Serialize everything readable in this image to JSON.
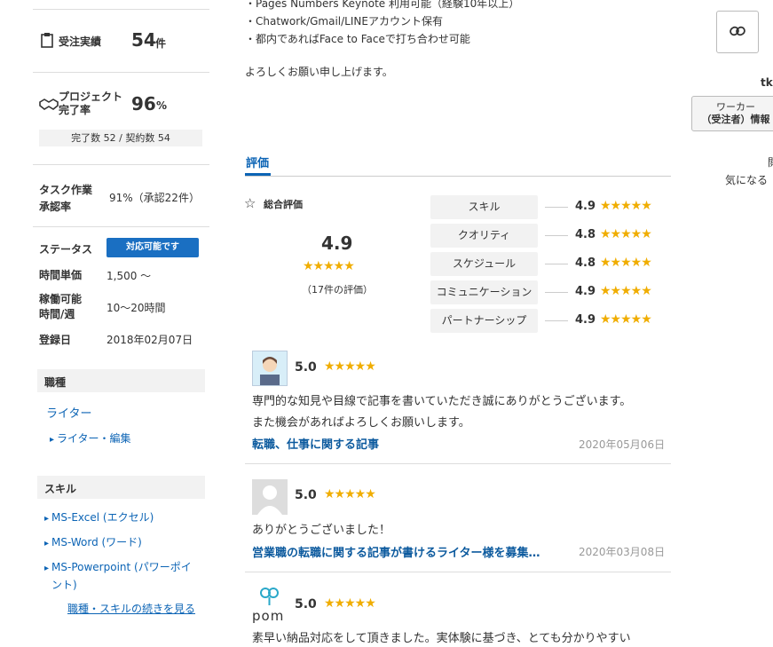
{
  "left": {
    "orders": {
      "label": "受注実績",
      "value": "54",
      "unit": "件"
    },
    "completion": {
      "label_line1": "プロジェクト",
      "label_line2": "完了率",
      "value": "96",
      "unit": "%",
      "detail": "完了数 52 / 契約数 54"
    },
    "task": {
      "label_line1": "タスク作業",
      "label_line2": "承認率",
      "value": "91%（承認22件）"
    },
    "status": {
      "label": "ステータス",
      "badge": "対応可能です"
    },
    "hourly": {
      "label": "時間単価",
      "value": "1,500 ～"
    },
    "hours": {
      "label_line1": "稼働可能",
      "label_line2": "時間/週",
      "value": "10～20時間"
    },
    "registered": {
      "label": "登録日",
      "value": "2018年02月07日"
    },
    "job_section": {
      "title": "職種",
      "category": "ライター",
      "sub": "ライター・編集"
    },
    "skill_section": {
      "title": "スキル",
      "items": [
        "MS-Excel (エクセル)",
        "MS-Word (ワード)",
        "MS-Powerpoint (パワーポイ",
        "ント)"
      ],
      "more_link": "職種・スキルの続きを見る"
    }
  },
  "intro": {
    "lines": [
      "・Pages Numbers Keynote 利用可能（経験10年以上）",
      "・Chatwork/Gmail/LINEアカウント保有",
      "・都内であればFace to Faceで打ち合わせ可能"
    ],
    "closing": "よろしくお願い申し上げます。"
  },
  "tab": {
    "label": "評価"
  },
  "overall": {
    "label": "総合評価",
    "score": "4.9",
    "stars": "★★★★★",
    "count": "（17件の評価）"
  },
  "categories": [
    {
      "name": "スキル",
      "score": "4.9",
      "stars": "★★★★★"
    },
    {
      "name": "クオリティ",
      "score": "4.8",
      "stars": "★★★★★"
    },
    {
      "name": "スケジュール",
      "score": "4.8",
      "stars": "★★★★★"
    },
    {
      "name": "コミュニケーション",
      "score": "4.9",
      "stars": "★★★★★"
    },
    {
      "name": "パートナーシップ",
      "score": "4.9",
      "stars": "★★★★★"
    }
  ],
  "reviews": [
    {
      "score": "5.0",
      "stars": "★★★★★",
      "text_line1": "専門的な知見や目線で記事を書いていただき誠にありがとうございます。",
      "text_line2": "また機会があればよろしくお願いします。",
      "title": "転職、仕事に関する記事",
      "date": "2020年05月06日"
    },
    {
      "score": "5.0",
      "stars": "★★★★★",
      "text_line1": "ありがとうございました！",
      "title": "営業職の転職に関する記事が書けるライター様を募集…",
      "date": "2020年03月08日"
    },
    {
      "score": "5.0",
      "stars": "★★★★★",
      "text_line1": "素早い納品対応をして頂きました。実体験に基づき、とても分かりやすい",
      "avatar_text": "pom"
    }
  ],
  "right": {
    "name_partial": "tkı",
    "worker_button_line1": "ワーカー",
    "worker_button_line2": "（受注者）情報",
    "side_text1": "閲",
    "side_text2": "気になる"
  }
}
